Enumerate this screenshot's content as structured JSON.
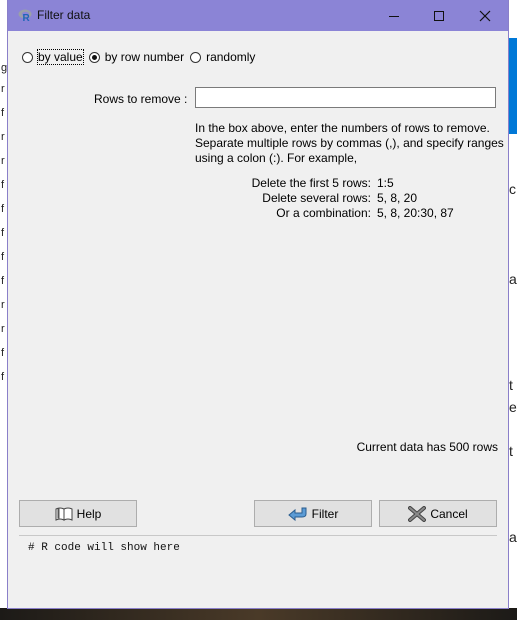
{
  "window": {
    "title": "Filter data"
  },
  "mode": {
    "options": [
      {
        "label": "by value",
        "selected": false
      },
      {
        "label": "by row number",
        "selected": true
      },
      {
        "label": "randomly",
        "selected": false
      }
    ]
  },
  "rows_to_remove": {
    "label": "Rows to remove :",
    "value": ""
  },
  "instructions": "In the box above, enter the numbers of rows to remove. Separate multiple rows by commas (,), and specify ranges using a colon (:). For example,",
  "examples": [
    {
      "label": "Delete the first 5 rows:",
      "value": "1:5"
    },
    {
      "label": "Delete several rows:",
      "value": "5, 8, 20"
    },
    {
      "label": "Or a combination:",
      "value": "5, 8, 20:30, 87"
    }
  ],
  "status": "Current data has 500 rows",
  "buttons": {
    "help": "Help",
    "filter": "Filter",
    "cancel": "Cancel"
  },
  "code_preview": "# R code will show here",
  "background_left_chars": [
    "g",
    "r",
    "f",
    "r",
    "r",
    "r",
    "f",
    "f",
    "f",
    "f",
    "f",
    "f",
    "r",
    "r",
    "f",
    "f"
  ],
  "background_right_chars": [
    "c",
    "a",
    "t",
    "et",
    "t",
    "a"
  ],
  "colors": {
    "titlebar": "#8b84d6",
    "dialog_bg": "#f0f0f0",
    "button_bg": "#e1e1e1",
    "accent_blue": "#0078d7"
  }
}
